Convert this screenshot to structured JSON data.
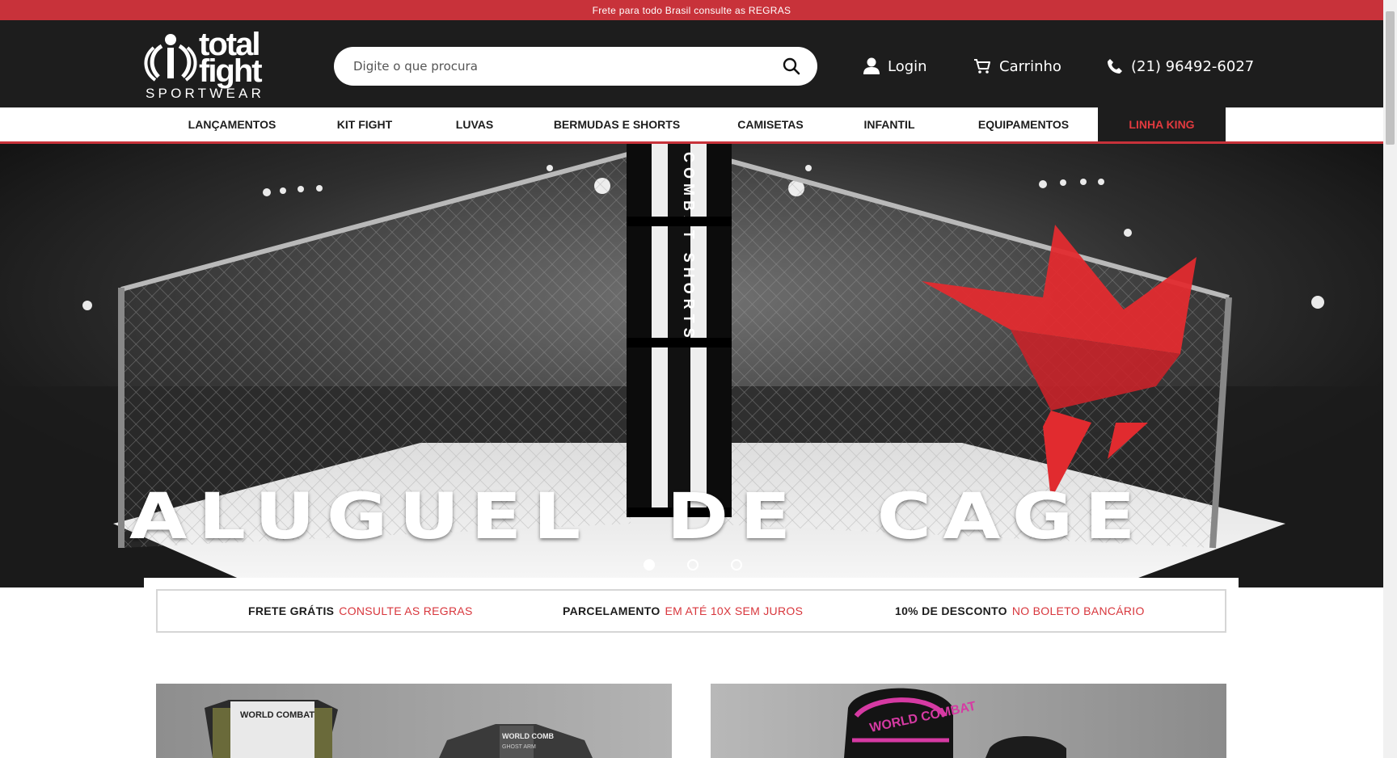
{
  "promo": {
    "text": "Frete para todo Brasil consulte as REGRAS"
  },
  "brand": {
    "line1": "total",
    "line2": "fight",
    "line3": "SPORTWEAR"
  },
  "search": {
    "placeholder": "Digite o que procura"
  },
  "header_links": {
    "login": "Login",
    "cart": "Carrinho",
    "phone": "(21) 96492-6027"
  },
  "nav": {
    "items": [
      {
        "label": "LANÇAMENTOS"
      },
      {
        "label": "KIT FIGHT"
      },
      {
        "label": "LUVAS"
      },
      {
        "label": "BERMUDAS E SHORTS"
      },
      {
        "label": "CAMISETAS"
      },
      {
        "label": "INFANTIL"
      },
      {
        "label": "EQUIPAMENTOS"
      },
      {
        "label": "LINHA KING"
      }
    ]
  },
  "hero": {
    "title": "ALUGUEL  DE  CAGE",
    "pole_text": "COMBAT SHORTS",
    "slides": 3,
    "active_slide": 1
  },
  "benefits": [
    {
      "strong": "FRETE GRÁTIS",
      "accent": "CONSULTE AS REGRAS"
    },
    {
      "strong": "PARCELAMENTO",
      "accent": "EM ATÉ 10X SEM JUROS"
    },
    {
      "strong": "10% DE DESCONTO",
      "accent": "NO BOLETO BANCÁRIO"
    }
  ],
  "products": {
    "left_tag": "WORLD COMBAT",
    "left_tag2": "WORLD COMB",
    "left_tag3": "GHOST ARM",
    "right_tag": "WORLD COMBAT"
  },
  "colors": {
    "accent": "#c8323a",
    "dark": "#1d1d1d",
    "king_text": "#e23a3f"
  }
}
